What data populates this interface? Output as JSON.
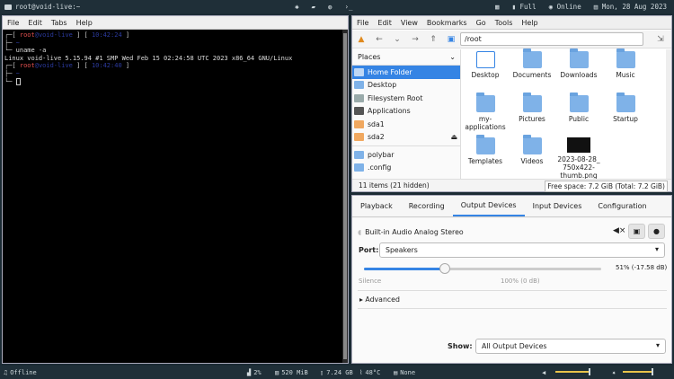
{
  "topbar": {
    "title": "root@void-live:~",
    "center_icons": [
      "bluetooth-icon",
      "folder-icon",
      "globe-icon",
      "terminal-icon"
    ],
    "battery": "Full",
    "network": "Online",
    "date": "Mon, 28 Aug 2023"
  },
  "terminal": {
    "menu": [
      "File",
      "Edit",
      "Tabs",
      "Help"
    ],
    "prompt1_user": "root",
    "prompt1_host": "void-live",
    "prompt1_time": "10:42:24",
    "prompt1_dir": "~",
    "command": "uname -a",
    "output": "Linux void-live 5.15.94 #1 SMP Wed Feb 15 02:24:58 UTC 2023 x86_64 GNU/Linux",
    "prompt2_user": "root",
    "prompt2_host": "void-live",
    "prompt2_time": "10:42:40",
    "prompt2_dir": "~"
  },
  "filemanager": {
    "menu": [
      "File",
      "Edit",
      "View",
      "Bookmarks",
      "Go",
      "Tools",
      "Help"
    ],
    "path": "/root",
    "places_label": "Places",
    "places": [
      {
        "label": "Home Folder",
        "selected": true,
        "icon": "home-folder-icon"
      },
      {
        "label": "Desktop",
        "icon": "folder-icon"
      },
      {
        "label": "Filesystem Root",
        "icon": "drive-icon"
      },
      {
        "label": "Applications",
        "icon": "applications-icon"
      },
      {
        "label": "sda1",
        "icon": "disk-icon"
      },
      {
        "label": "sda2",
        "icon": "disk-icon",
        "eject": true
      }
    ],
    "bookmarks": [
      {
        "label": "polybar",
        "icon": "folder-icon"
      },
      {
        "label": ".config",
        "icon": "folder-icon"
      }
    ],
    "files": [
      {
        "label": "Desktop",
        "type": "doc"
      },
      {
        "label": "Documents",
        "type": "folder"
      },
      {
        "label": "Downloads",
        "type": "folder"
      },
      {
        "label": "Music",
        "type": "folder"
      },
      {
        "label": "my-\napplications",
        "type": "folder"
      },
      {
        "label": "Pictures",
        "type": "folder"
      },
      {
        "label": "Public",
        "type": "folder"
      },
      {
        "label": "Startup",
        "type": "folder"
      },
      {
        "label": "Templates",
        "type": "folder"
      },
      {
        "label": "Videos",
        "type": "folder"
      },
      {
        "label": "2023-08-28_\n750x422-\nthumb.png",
        "type": "image"
      }
    ],
    "status_items": "11 items (21 hidden)",
    "free_space": "Free space: 7.2 GiB (Total: 7.2 GiB)"
  },
  "volume": {
    "tabs": [
      "Playback",
      "Recording",
      "Output Devices",
      "Input Devices",
      "Configuration"
    ],
    "active_tab": 2,
    "device_name": "Built-in Audio Analog Stereo",
    "port_label": "Port:",
    "port_value": "Speakers",
    "level_text": "51% (-17.58 dB)",
    "level_fraction": 0.34,
    "silence_label": "Silence",
    "hundred_label": "100% (0 dB)",
    "advanced_label": "Advanced",
    "show_label": "Show:",
    "show_value": "All Output Devices"
  },
  "bottombar": {
    "mpd": "Offline",
    "cpu": "2%",
    "mem": "520 MiB",
    "disk": "7.24 GB",
    "temp": "48°C",
    "updates": "None",
    "volume_level": 0.7,
    "brightness_level": 0.6
  },
  "colors": {
    "accent": "#3584e4",
    "bar_bg": "#1f2f38",
    "prompt_user": "#e04f4f",
    "prompt_host": "#2b3a9e"
  }
}
